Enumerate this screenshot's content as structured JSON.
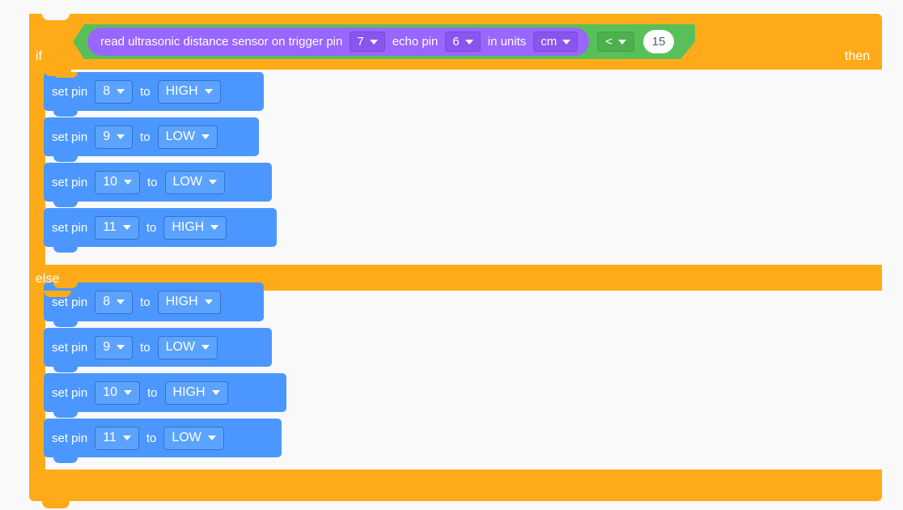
{
  "workspace": {
    "background_color": "#f9f9f9"
  },
  "colors": {
    "control_orange": "#ffab19",
    "operator_green": "#59c059",
    "sensor_purple": "#9966ff",
    "pin_blue": "#4c97ff",
    "number_input_text": "#575e75",
    "label_text": "#ffffff"
  },
  "if_block": {
    "if_label": "if",
    "then_label": "then",
    "else_label": "else",
    "condition": {
      "operator_label": "<",
      "operator_icon": "chevron-down-icon",
      "value": "15",
      "reporter": {
        "text_1": "read ultrasonic distance sensor on trigger pin",
        "trigger_pin": "7",
        "text_2": "echo pin",
        "echo_pin": "6",
        "text_3": "in units",
        "units": "cm",
        "dropdown_icon": "chevron-down-icon"
      }
    },
    "then_branch": {
      "blocks": [
        {
          "prefix": "set pin",
          "pin": "8",
          "middle": "to",
          "state": "HIGH"
        },
        {
          "prefix": "set pin",
          "pin": "9",
          "middle": "to",
          "state": "LOW"
        },
        {
          "prefix": "set pin",
          "pin": "10",
          "middle": "to",
          "state": "LOW"
        },
        {
          "prefix": "set pin",
          "pin": "11",
          "middle": "to",
          "state": "HIGH"
        }
      ]
    },
    "else_branch": {
      "blocks": [
        {
          "prefix": "set pin",
          "pin": "8",
          "middle": "to",
          "state": "HIGH"
        },
        {
          "prefix": "set pin",
          "pin": "9",
          "middle": "to",
          "state": "LOW"
        },
        {
          "prefix": "set pin",
          "pin": "10",
          "middle": "to",
          "state": "HIGH"
        },
        {
          "prefix": "set pin",
          "pin": "11",
          "middle": "to",
          "state": "LOW"
        }
      ]
    }
  }
}
